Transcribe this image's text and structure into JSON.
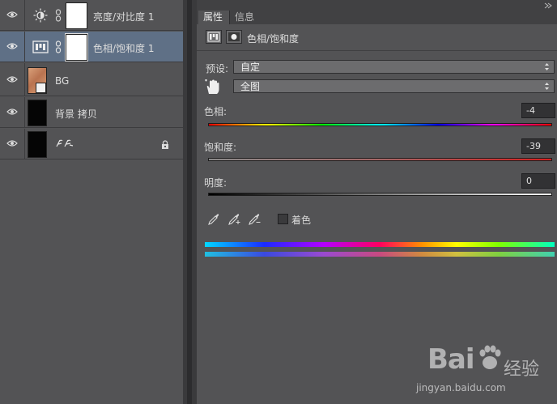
{
  "layers_panel": {
    "layers": [
      {
        "name": "亮度/对比度 1",
        "kind": "adjustment",
        "icon": "brightness-contrast-icon",
        "selected": false
      },
      {
        "name": "色相/饱和度 1",
        "kind": "adjustment",
        "icon": "hue-saturation-icon",
        "selected": true
      },
      {
        "name": "BG",
        "kind": "smart-object",
        "icon": "image-thumbnail",
        "selected": false
      },
      {
        "name": "背景 拷贝",
        "kind": "image",
        "icon": "black-thumbnail",
        "selected": false
      },
      {
        "name": "",
        "kind": "locked",
        "icon": "black-thumbnail",
        "selected": false
      }
    ]
  },
  "properties_panel": {
    "tabs": [
      {
        "label": "属性",
        "active": true
      },
      {
        "label": "信息",
        "active": false
      }
    ],
    "header_title": "色相/饱和度",
    "preset_label": "预设:",
    "preset_value": "自定",
    "channel_value": "全图",
    "sliders": [
      {
        "label": "色相:",
        "value": "-4",
        "level": 0.48
      },
      {
        "label": "饱和度:",
        "value": "-39",
        "level": 0.31
      },
      {
        "label": "明度:",
        "value": "0",
        "level": 0.5
      }
    ],
    "colorize_label": "着色"
  },
  "watermark": {
    "brand": "Bai",
    "brand_cn": "经验",
    "url": "jingyan.baidu.com"
  },
  "colors": {
    "panel_bg": "#535355",
    "selected_row": "#5f7086",
    "field_bg": "#323234"
  }
}
